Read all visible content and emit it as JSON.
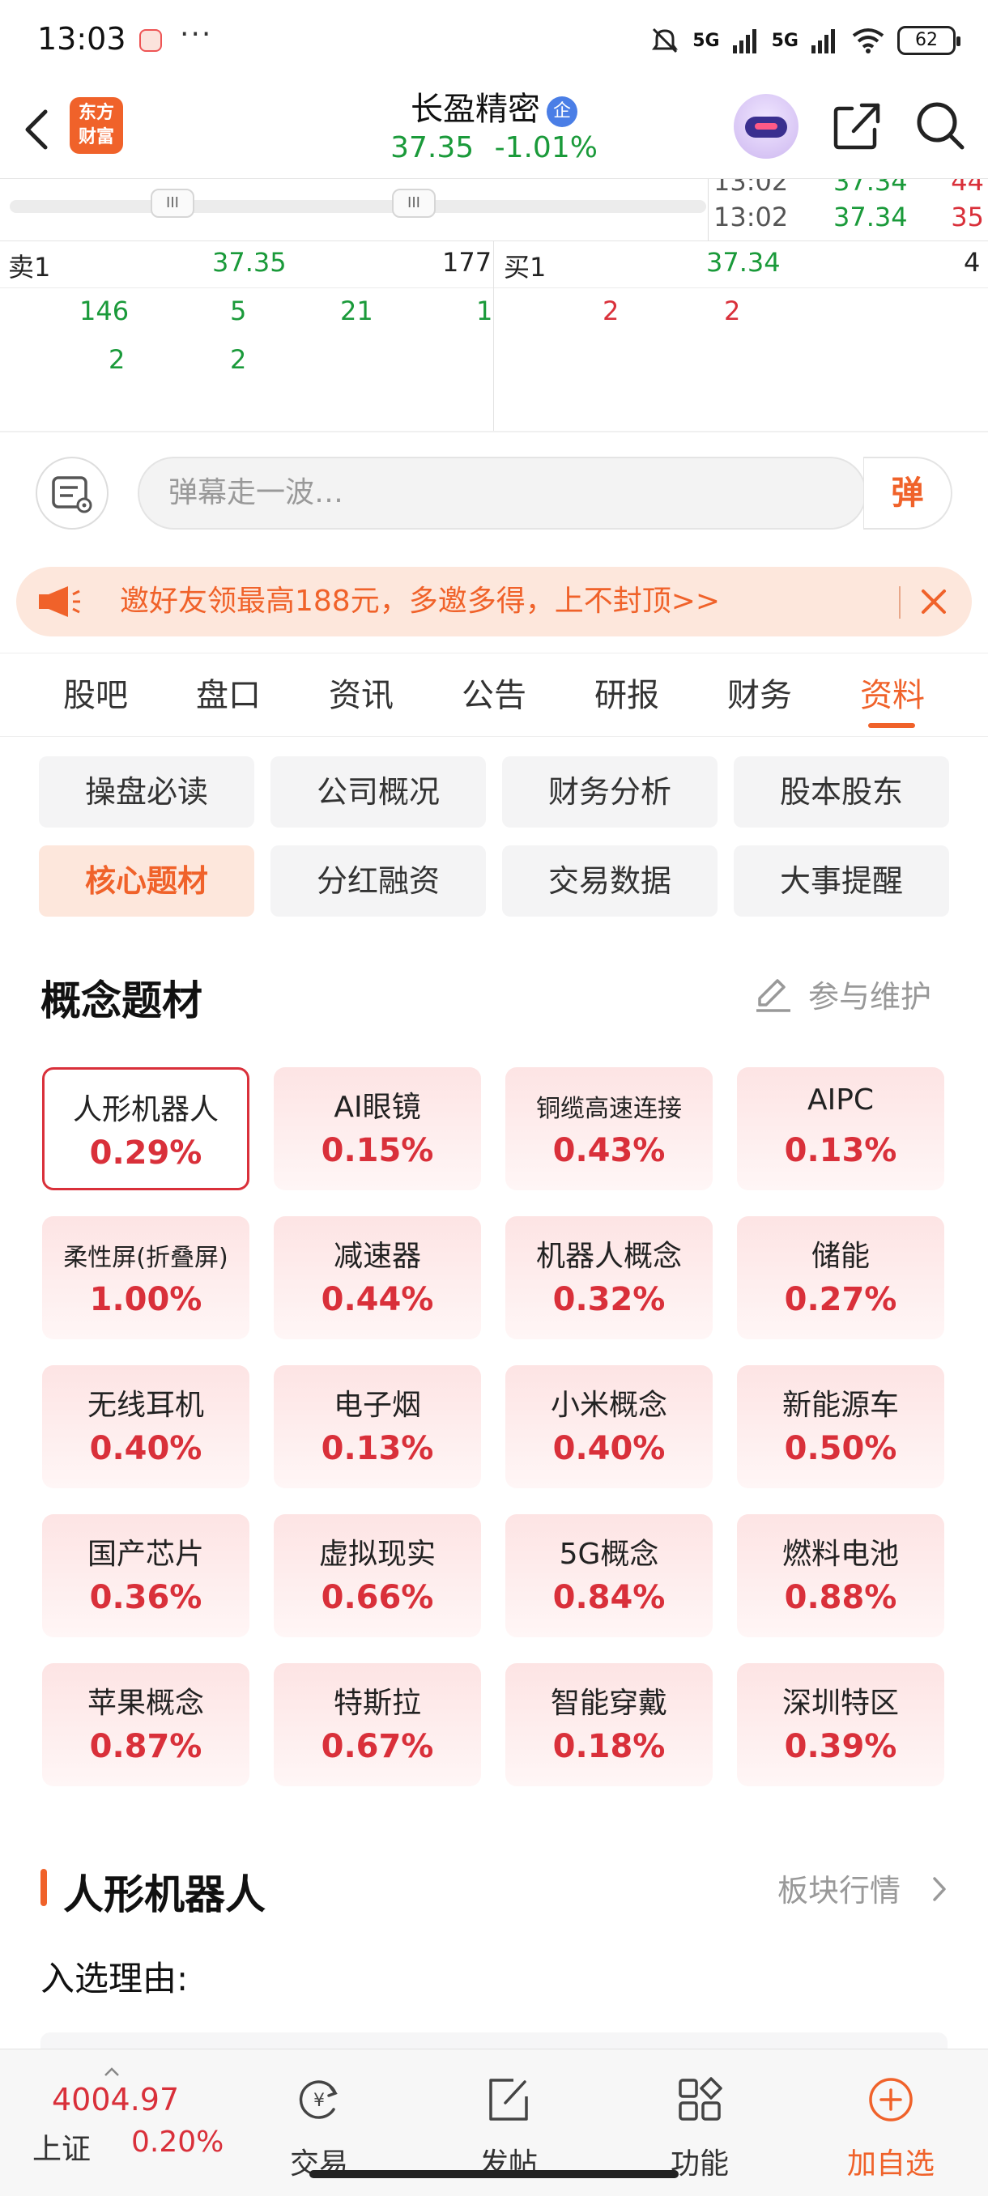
{
  "status_bar": {
    "time": "13:03",
    "more": "···",
    "signal1": "5G",
    "signal2": "5G",
    "wifi_sub": "6",
    "battery": "62"
  },
  "header": {
    "logo_line1": "东方",
    "logo_line2": "财富",
    "stock_name": "长盈精密",
    "badge": "企",
    "price": "37.35",
    "change_pct": "-1.01%"
  },
  "ticks": [
    {
      "time": "13:02",
      "price": "37.34",
      "volume": "44"
    },
    {
      "time": "13:02",
      "price": "37.34",
      "volume": "35"
    }
  ],
  "slider": {
    "handle": "III"
  },
  "order_book": {
    "sell_label": "卖1",
    "sell_price": "37.35",
    "sell_volume": "177",
    "buy_label": "买1",
    "buy_price": "37.34",
    "buy_volume": "4",
    "sell_row1": [
      "146",
      "5",
      "21",
      "1"
    ],
    "sell_row2": [
      "2",
      "2"
    ],
    "buy_row1": [
      "2",
      "2"
    ]
  },
  "danmu": {
    "placeholder": "弹幕走一波…",
    "send": "弹"
  },
  "promo": {
    "text": "邀好友领最高188元，多邀多得，上不封顶>>"
  },
  "tabs": [
    "股吧",
    "盘口",
    "资讯",
    "公告",
    "研报",
    "财务",
    "资料"
  ],
  "active_tab": "资料",
  "chips": [
    "操盘必读",
    "公司概况",
    "财务分析",
    "股本股东",
    "核心题材",
    "分红融资",
    "交易数据",
    "大事提醒"
  ],
  "active_chip": "核心题材",
  "concepts": {
    "title": "概念题材",
    "maintain": "参与维护",
    "items": [
      {
        "name": "人形机器人",
        "pct": "0.29%"
      },
      {
        "name": "AI眼镜",
        "pct": "0.15%"
      },
      {
        "name": "铜缆高速连接",
        "pct": "0.43%"
      },
      {
        "name": "AIPC",
        "pct": "0.13%"
      },
      {
        "name": "柔性屏(折叠屏)",
        "pct": "1.00%"
      },
      {
        "name": "减速器",
        "pct": "0.44%"
      },
      {
        "name": "机器人概念",
        "pct": "0.32%"
      },
      {
        "name": "储能",
        "pct": "0.27%"
      },
      {
        "name": "无线耳机",
        "pct": "0.40%"
      },
      {
        "name": "电子烟",
        "pct": "0.13%"
      },
      {
        "name": "小米概念",
        "pct": "0.40%"
      },
      {
        "name": "新能源车",
        "pct": "0.50%"
      },
      {
        "name": "国产芯片",
        "pct": "0.36%"
      },
      {
        "name": "虚拟现实",
        "pct": "0.66%"
      },
      {
        "name": "5G概念",
        "pct": "0.84%"
      },
      {
        "name": "燃料电池",
        "pct": "0.88%"
      },
      {
        "name": "苹果概念",
        "pct": "0.87%"
      },
      {
        "name": "特斯拉",
        "pct": "0.67%"
      },
      {
        "name": "智能穿戴",
        "pct": "0.18%"
      },
      {
        "name": "深圳特区",
        "pct": "0.39%"
      }
    ]
  },
  "selected_concept": {
    "title": "人形机器人",
    "link": "板块行情",
    "reason_label": "入选理由:"
  },
  "bottom_bar": {
    "index_value": "4004.97",
    "index_name": "上证",
    "index_change": "0.20%",
    "nav": [
      "交易",
      "发帖",
      "功能",
      "加自选"
    ]
  },
  "colors": {
    "accent": "#f0622a",
    "up": "#d9303a",
    "down": "#1a9a3a"
  },
  "icons": [
    "back-icon",
    "robot-assistant-icon",
    "share-icon",
    "search-icon",
    "danmu-list-icon",
    "megaphone-icon",
    "close-icon",
    "edit-icon",
    "chevron-right-icon",
    "trade-icon",
    "post-icon",
    "apps-icon",
    "add-circle-icon"
  ]
}
